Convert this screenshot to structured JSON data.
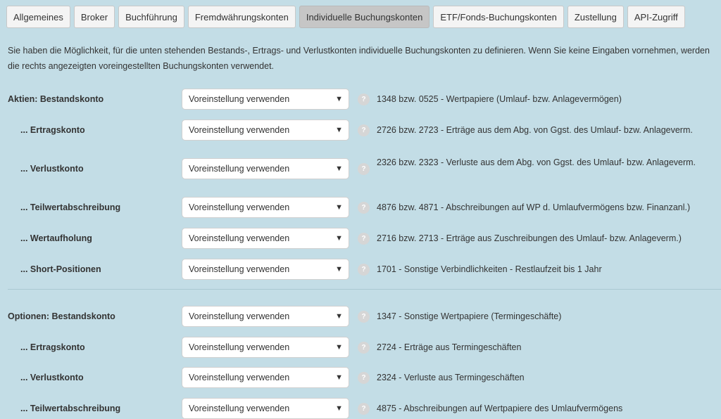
{
  "tabs": [
    {
      "label": "Allgemeines"
    },
    {
      "label": "Broker"
    },
    {
      "label": "Buchführung"
    },
    {
      "label": "Fremdwährungskonten"
    },
    {
      "label": "Individuelle Buchungskonten",
      "active": true
    },
    {
      "label": "ETF/Fonds-Buchungskonten"
    },
    {
      "label": "Zustellung"
    },
    {
      "label": "API-Zugriff"
    }
  ],
  "intro": "Sie haben die Möglichkeit, für die unten stehenden Bestands-, Ertrags- und Verlustkonten individuelle Buchungskonten zu definieren. Wenn Sie keine Eingaben vornehmen, werden die rechts angezeigten voreingestellten Buchungskonten verwendet.",
  "select_value": "Voreinstellung verwenden",
  "help_glyph": "?",
  "arrow_glyph": "▼",
  "aktien": {
    "rows": [
      {
        "label": "Aktien: Bestandskonto",
        "desc": "1348 bzw. 0525 - Wertpapiere (Umlauf- bzw. Anlagevermögen)"
      },
      {
        "label": "... Ertragskonto",
        "desc": "2726 bzw. 2723 - Erträge aus dem Abg. von Ggst. des Umlauf- bzw. Anlageverm."
      },
      {
        "label": "... Verlustkonto",
        "desc": "2326 bzw. 2323 - Verluste aus dem Abg. von Ggst. des Umlauf- bzw. Anlageverm."
      },
      {
        "label": "... Teilwertabschreibung",
        "desc": "4876 bzw. 4871 - Abschreibungen auf WP d. Umlaufvermögens bzw. Finanzanl.)"
      },
      {
        "label": "... Wertaufholung",
        "desc": "2716 bzw. 2713 - Erträge aus Zuschreibungen des Umlauf- bzw. Anlageverm.)"
      },
      {
        "label": "... Short-Positionen",
        "desc": "1701 - Sonstige Verbindlichkeiten - Restlaufzeit bis 1 Jahr"
      }
    ]
  },
  "optionen": {
    "rows": [
      {
        "label": "Optionen: Bestandskonto",
        "desc": "1347 - Sonstige Wertpapiere (Termingeschäfte)"
      },
      {
        "label": "... Ertragskonto",
        "desc": "2724 - Erträge aus Termingeschäften"
      },
      {
        "label": "... Verlustkonto",
        "desc": "2324 - Verluste aus Termingeschäften"
      },
      {
        "label": "... Teilwertabschreibung",
        "desc": "4875 - Abschreibungen auf Wertpapiere des Umlaufvermögens"
      }
    ]
  }
}
